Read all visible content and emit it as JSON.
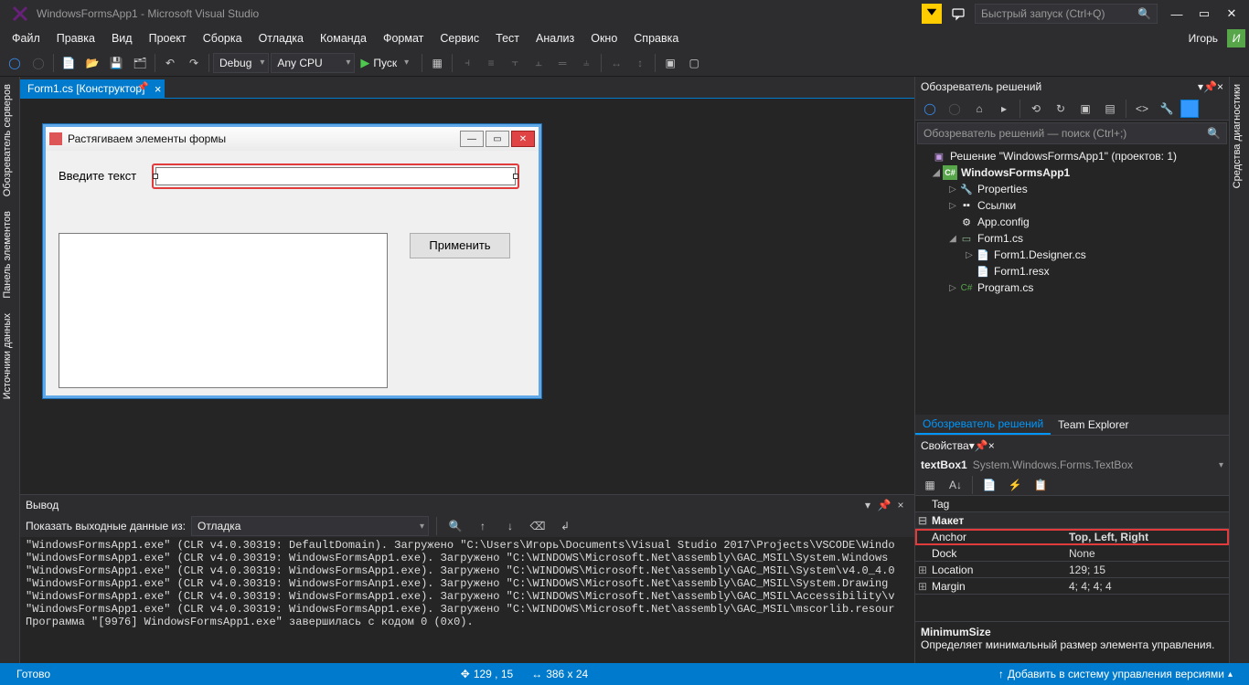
{
  "titlebar": {
    "title": "WindowsFormsApp1 - Microsoft Visual Studio",
    "quick_launch_placeholder": "Быстрый запуск (Ctrl+Q)"
  },
  "menu": {
    "file": "Файл",
    "edit": "Правка",
    "view": "Вид",
    "project": "Проект",
    "build": "Сборка",
    "debug": "Отладка",
    "team": "Команда",
    "format": "Формат",
    "service": "Сервис",
    "test": "Тест",
    "analyze": "Анализ",
    "window": "Окно",
    "help": "Справка",
    "user": "Игорь",
    "user_initial": "И"
  },
  "toolbar": {
    "config": "Debug",
    "platform": "Any CPU",
    "start": "Пуск"
  },
  "tabs": {
    "form1": "Form1.cs [Конструктор]"
  },
  "winform": {
    "title": "Растягиваем элементы формы",
    "label": "Введите текст",
    "apply": "Применить"
  },
  "output": {
    "title": "Вывод",
    "show_from_label": "Показать выходные данные из:",
    "show_from_value": "Отладка",
    "lines": [
      "\"WindowsFormsApp1.exe\" (CLR v4.0.30319: DefaultDomain). Загружено \"C:\\Users\\Игорь\\Documents\\Visual Studio 2017\\Projects\\VSCODE\\Windo",
      "\"WindowsFormsApp1.exe\" (CLR v4.0.30319: WindowsFormsApp1.exe). Загружено \"C:\\WINDOWS\\Microsoft.Net\\assembly\\GAC_MSIL\\System.Windows",
      "\"WindowsFormsApp1.exe\" (CLR v4.0.30319: WindowsFormsApp1.exe). Загружено \"C:\\WINDOWS\\Microsoft.Net\\assembly\\GAC_MSIL\\System\\v4.0_4.0",
      "\"WindowsFormsApp1.exe\" (CLR v4.0.30319: WindowsFormsAnp1.exe). Загружено \"C:\\WINDOWS\\Microsoft.Net\\assembly\\GAC_MSIL\\System.Drawing",
      "\"WindowsFormsApp1.exe\" (CLR v4.0.30319: WindowsFormsApp1.exe). Загружено \"C:\\WINDOWS\\Microsoft.Net\\assembly\\GAC_MSIL\\Accessibility\\v",
      "\"WindowsFormsApp1.exe\" (CLR v4.0.30319: WindowsFormsApp1.exe). Загружено \"C:\\WINDOWS\\Microsoft.Net\\assembly\\GAC_MSIL\\mscorlib.resour",
      "Программа \"[9976] WindowsFormsApp1.exe\" завершилась с кодом 0 (0x0)."
    ]
  },
  "solution_explorer": {
    "title": "Обозреватель решений",
    "search_placeholder": "Обозреватель решений — поиск (Ctrl+;)",
    "solution_label": "Решение \"WindowsFormsApp1\"  (проектов: 1)",
    "project": "WindowsFormsApp1",
    "properties": "Properties",
    "references": "Ссылки",
    "appconfig": "App.config",
    "form1cs": "Form1.cs",
    "form1designer": "Form1.Designer.cs",
    "form1resx": "Form1.resx",
    "programcs": "Program.cs",
    "tab_solution": "Обозреватель решений",
    "tab_team": "Team Explorer"
  },
  "properties": {
    "title": "Свойства",
    "object_name": "textBox1",
    "object_type": "System.Windows.Forms.TextBox",
    "rows": {
      "tag": "Tag",
      "tag_v": "",
      "layout_cat": "Макет",
      "anchor": "Anchor",
      "anchor_v": "Top, Left, Right",
      "dock": "Dock",
      "dock_v": "None",
      "location": "Location",
      "location_v": "129; 15",
      "margin": "Margin",
      "margin_v": "4; 4; 4; 4"
    },
    "desc_title": "MinimumSize",
    "desc_text": "Определяет минимальный размер элемента управления."
  },
  "left_tabs": {
    "servers": "Обозреватель серверов",
    "toolbox": "Панель элементов",
    "datasources": "Источники данных"
  },
  "right_tabs": {
    "diagnostics": "Средства диагностики"
  },
  "status": {
    "ready": "Готово",
    "pos": "129 , 15",
    "size": "386 x 24",
    "add_source_control": "Добавить в систему управления версиями"
  }
}
